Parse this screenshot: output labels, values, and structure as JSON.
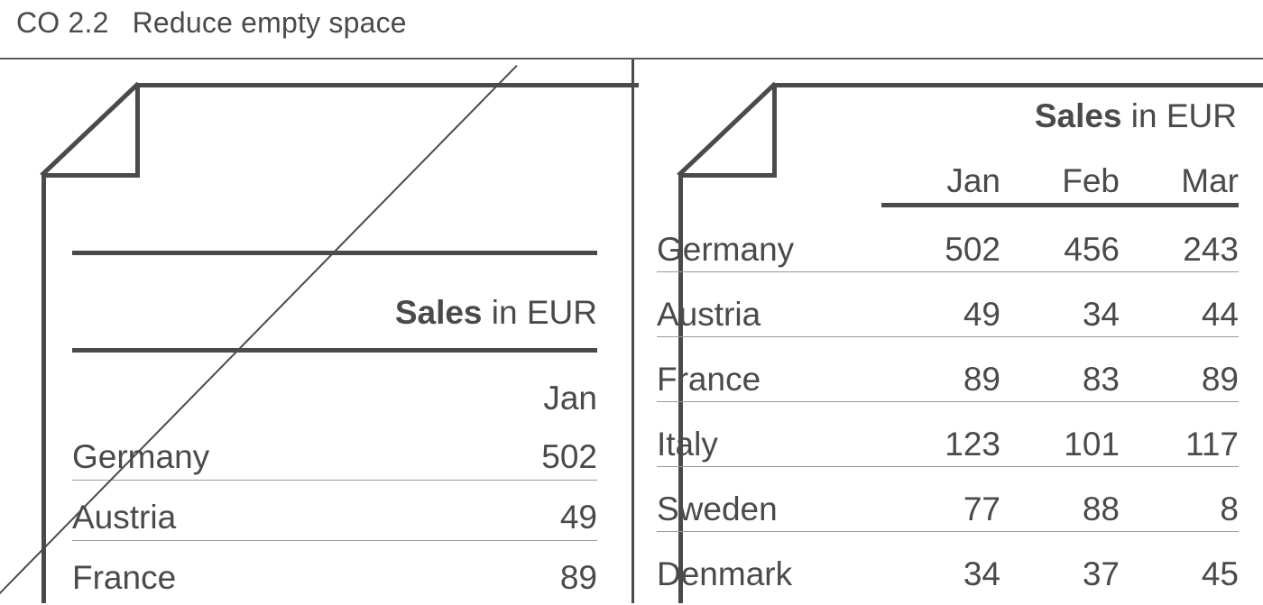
{
  "header": {
    "code": "CO 2.2",
    "title": "Reduce empty space"
  },
  "left_panel": {
    "name": "before-example",
    "table_title_bold": "Sales",
    "table_title_rest": " in EUR",
    "month_header": "Jan",
    "rows": [
      {
        "country": "Germany",
        "jan": "502"
      },
      {
        "country": "Austria",
        "jan": "49"
      },
      {
        "country": "France",
        "jan": "89"
      }
    ]
  },
  "right_panel": {
    "name": "after-example",
    "table_title_bold": "Sales",
    "table_title_rest": " in EUR",
    "columns": [
      "",
      "Jan",
      "Feb",
      "Mar"
    ],
    "rows": [
      {
        "country": "Germany",
        "jan": "502",
        "feb": "456",
        "mar": "243"
      },
      {
        "country": "Austria",
        "jan": "49",
        "feb": "34",
        "mar": "44"
      },
      {
        "country": "France",
        "jan": "89",
        "feb": "83",
        "mar": "89"
      },
      {
        "country": "Italy",
        "jan": "123",
        "feb": "101",
        "mar": "117"
      },
      {
        "country": "Sweden",
        "jan": "77",
        "feb": "88",
        "mar": "8"
      },
      {
        "country": "Denmark",
        "jan": "34",
        "feb": "37",
        "mar": "45"
      }
    ]
  },
  "colors": {
    "ink": "#4a4a4a",
    "rule_light": "#9a9a9a",
    "background": "#ffffff"
  }
}
